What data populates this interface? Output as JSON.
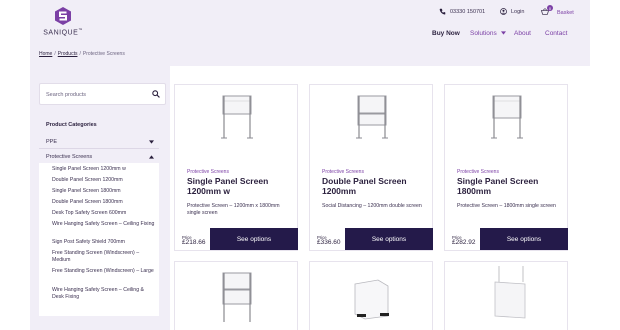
{
  "brand": {
    "name": "SANIQUE",
    "trademark": "™"
  },
  "utility": {
    "phone": "03330 150701",
    "login": "Login",
    "basket": "Basket",
    "basket_count": "0"
  },
  "nav": {
    "buy_now": "Buy Now",
    "solutions": "Solutions",
    "about": "About",
    "contact": "Contact"
  },
  "breadcrumb": [
    "Home",
    "Products",
    "Protective Screens"
  ],
  "search": {
    "placeholder": "Search products"
  },
  "categories": {
    "title": "Product Categories",
    "ppe": "PPE",
    "protective": "Protective Screens",
    "sub_items": [
      "Single Panel Screen 1200mm w",
      "Double Panel Screen 1200mm",
      "Single Panel Screen 1800mm",
      "Double Panel Screen 1800mm",
      "Desk Top Safety Screen 600mm",
      "Wire Hanging Safety Screen – Ceiling Fixing",
      "Sign Post Safety Shield 700mm",
      "Free Standing Screen (Windscreen) – Medium",
      "Free Standing Screen (Windscreen) – Large",
      "Wire Hanging Safety Screen – Ceiling & Desk Fixing"
    ]
  },
  "products": [
    {
      "category": "Protective Screens",
      "title": "Single Panel Screen 1200mm w",
      "description": "Protective Screen – 1200mm x 1800mm single screen",
      "price_label": "Price",
      "price": "£218.66",
      "button": "See options",
      "image_icon": "single-panel-screen-icon"
    },
    {
      "category": "Protective Screens",
      "title": "Double Panel Screen 1200mm",
      "description": "Social Distancing – 1200mm double screen",
      "price_label": "Price",
      "price": "£336.60",
      "button": "See options",
      "image_icon": "double-panel-screen-icon"
    },
    {
      "category": "Protective Screens",
      "title": "Single Panel Screen 1800mm",
      "description": "Protective Screen – 1800mm single screen",
      "price_label": "Price",
      "price": "£282.92",
      "button": "See options",
      "image_icon": "single-panel-screen-icon"
    }
  ],
  "colors": {
    "accent": "#7b3fa5",
    "button": "#241a4a",
    "panel_bg": "#f1eef7"
  }
}
